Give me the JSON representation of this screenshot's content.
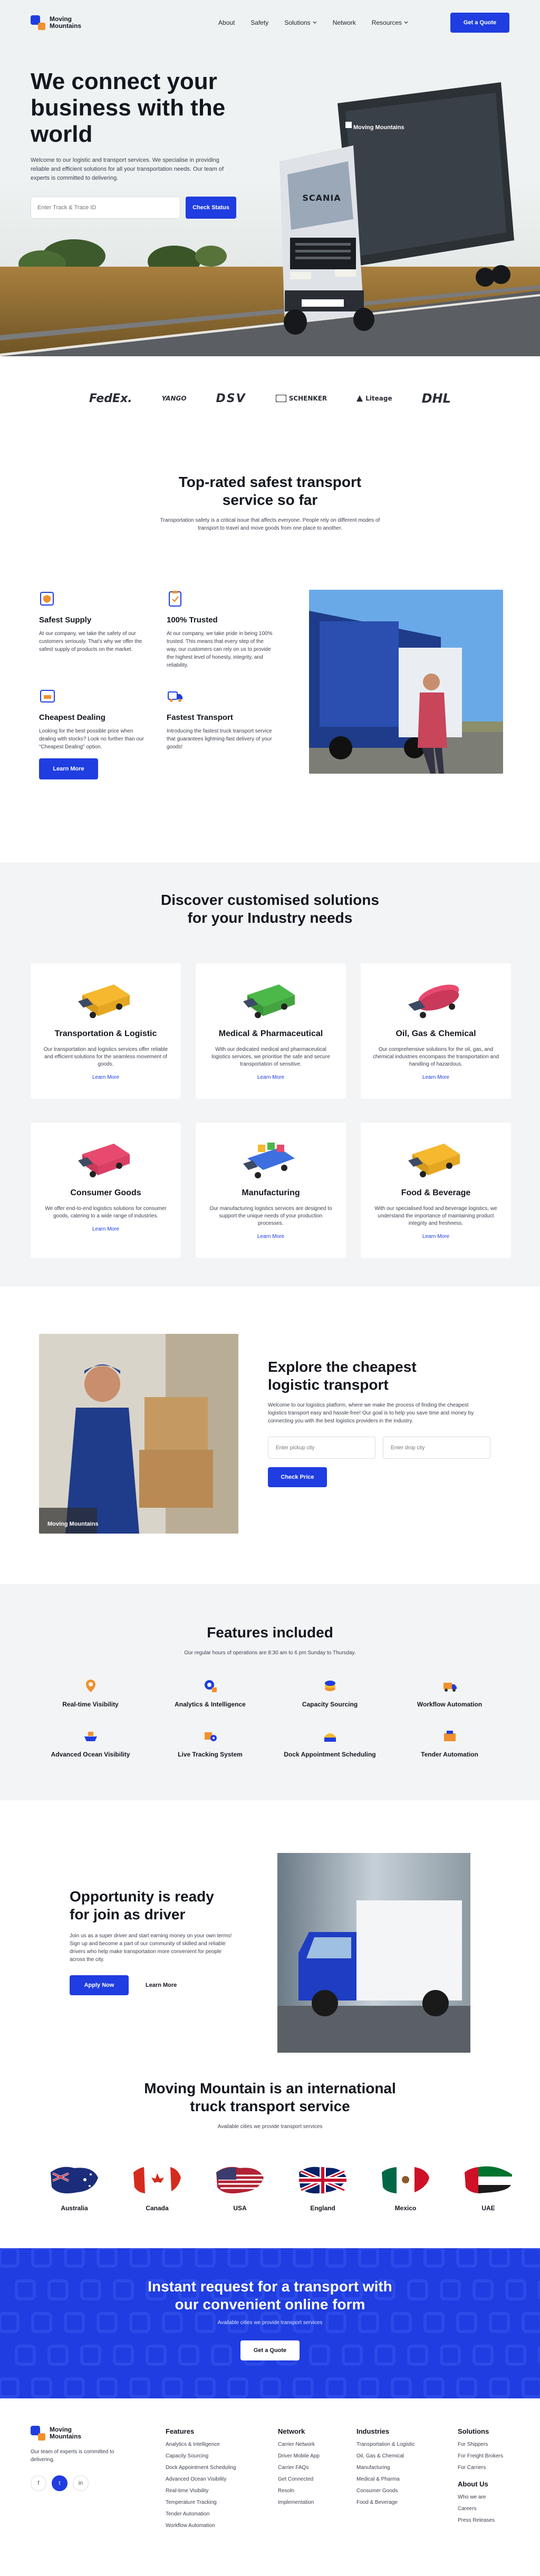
{
  "brand": {
    "name_line1": "Moving",
    "name_line2": "Mountains"
  },
  "nav": {
    "links": [
      "About",
      "Safety",
      "Solutions",
      "Network",
      "Resources"
    ],
    "cta": "Get a Quote"
  },
  "hero": {
    "title": "We connect your business with the world",
    "text": "Welcome to our logistic and transport services. We specialise in providing reliable and efficient solutions for all your transportation needs. Our team of experts is committed to delivering.",
    "track_placeholder": "Enter Track & Trace ID",
    "track_button": "Check Status",
    "truck_brand": "SCANIA",
    "trailer_logo": "Moving Mountains"
  },
  "partners": [
    "FedEx.",
    "YANGO",
    "DSV",
    "SCHENKER",
    "Liteage",
    "DHL"
  ],
  "safest": {
    "title_line1": "Top-rated safest transport",
    "title_line2": "service so far",
    "subtitle": "Transportation safety is a critical issue that affects everyone. People rely on different modes of transport to travel and move goods from one place to another.",
    "features": [
      {
        "title": "Safest Supply",
        "text": "At our company, we take the safety of our customers seriously. That's why we offer the safest supply of products on the market.",
        "icon": "shield-box-icon"
      },
      {
        "title": "100% Trusted",
        "text": "At our company, we take pride in being 100% trusted. This means that every step of the way, our customers can rely on us to provide the highest level of honesty, integrity, and reliability.",
        "icon": "clipboard-check-icon"
      },
      {
        "title": "Cheapest Dealing",
        "text": "Looking for the best possible price when dealing with stocks? Look no further than our \"Cheapest Dealing\" option.",
        "icon": "tag-icon"
      },
      {
        "title": "Fastest Transport",
        "text": "Introducing the fastest truck transport service that guarantees lightning-fast delivery of your goods!",
        "icon": "truck-icon"
      }
    ],
    "button": "Learn More"
  },
  "solutions": {
    "title_line1": "Discover customised solutions",
    "title_line2": "for your Industry needs",
    "cards": [
      {
        "title": "Transportation & Logistic",
        "text": "Our transportation and logistics services offer reliable and efficient solutions for the seamless movement of goods.",
        "link": "Learn More",
        "color": "#f5b82e"
      },
      {
        "title": "Medical & Pharmaceutical",
        "text": "With our dedicated medical and pharmaceutical logistics services, we prioritise the safe and secure transportation of sensitive.",
        "link": "Learn More",
        "color": "#4cb84a"
      },
      {
        "title": "Oil, Gas & Chemical",
        "text": "Our comprehensive solutions for the oil, gas, and chemical industries encompass the transportation and handling of hazardous.",
        "link": "Learn More",
        "color": "#e84a6f"
      },
      {
        "title": "Consumer Goods",
        "text": "We offer end-to-end logistics solutions for consumer goods, catering to a wide range of industries.",
        "link": "Learn More",
        "color": "#e84a6f"
      },
      {
        "title": "Manufacturing",
        "text": "Our manufacturing logistics services are designed to support the unique needs of your production processes.",
        "link": "Learn More",
        "color": "#3d6fe0"
      },
      {
        "title": "Food & Beverage",
        "text": "With our specialised food and beverage logistics, we understand the importance of maintaining product integrity and freshness.",
        "link": "Learn More",
        "color": "#f5b82e"
      }
    ]
  },
  "cheapest": {
    "title_line1": "Explore the cheapest",
    "title_line2": "logistic transport",
    "text": "Welcome to our logistics platform, where we make the process of finding the cheapest logistics transport easy and hassle-free! Our goal is to help you save time and money by connecting you with the best logistics providers in the industry.",
    "pickup_placeholder": "Enter pickup city",
    "drop_placeholder": "Enter drop city",
    "button": "Check Price",
    "photo_logo": "Moving Mountains"
  },
  "included": {
    "title": "Features included",
    "subtitle": "Our regular hours of operations are 8:30 am to 6 pm Sunday to Thursday.",
    "items": [
      {
        "label": "Real-time Visibility",
        "icon": "location-pin-icon"
      },
      {
        "label": "Analytics & Intelligence",
        "icon": "settings-chart-icon"
      },
      {
        "label": "Capacity Sourcing",
        "icon": "dollar-coins-icon"
      },
      {
        "label": "Workflow Automation",
        "icon": "truck-automation-icon"
      },
      {
        "label": "Advanced Ocean Visibility",
        "icon": "ship-icon"
      },
      {
        "label": "Live Tracking System",
        "icon": "tracking-box-icon"
      },
      {
        "label": "Dock Appointment Scheduling",
        "icon": "dock-calendar-icon"
      },
      {
        "label": "Tender Automation",
        "icon": "tender-box-icon"
      }
    ]
  },
  "driver": {
    "title_line1": "Opportunity is ready",
    "title_line2": "for join as driver",
    "text": "Join us as a super driver and start earning money on your own terms! Sign up and become a part of our community of skilled and reliable drivers who help make transportation more convenient for people across the city.",
    "apply": "Apply Now",
    "learn": "Learn More"
  },
  "countries": {
    "title_line1": "Moving Mountain is an international",
    "title_line2": "truck transport service",
    "subtitle": "Available cities we provide transport services",
    "list": [
      "Australia",
      "Canada",
      "USA",
      "England",
      "Mexico",
      "UAE"
    ]
  },
  "cta": {
    "title_line1": "Instant request for a transport with",
    "title_line2": "our convenient online form",
    "subtitle": "Available cities we provide transport services",
    "button": "Get a Quote"
  },
  "footer": {
    "tagline": "Our team of experts is committed to delivering.",
    "socials": [
      "f",
      "t",
      "in"
    ],
    "features": {
      "title": "Features",
      "items": [
        "Analytics & Intelligence",
        "Capacity Sourcing",
        "Dock Appointment Scheduling",
        "Advanced Ocean Visibility",
        "Real-time Visibility",
        "Temperature Tracking",
        "Tender Automation",
        "Workflow Automation"
      ]
    },
    "network": {
      "title": "Network",
      "items": [
        "Carrier Network",
        "Driver Mobile App",
        "Carrier FAQs",
        "Get Connected",
        "Resoln",
        "Implementation"
      ]
    },
    "industries": {
      "title": "Industries",
      "items": [
        "Transportation & Logistic",
        "Oil, Gas & Chemical",
        "Manufacturing",
        "Medical & Pharma",
        "Consumer Goods",
        "Food & Beverage"
      ]
    },
    "solutions": {
      "title": "Solutions",
      "items": [
        "For Shippers",
        "For Freight Brokers",
        "For Carriers"
      ]
    },
    "about": {
      "title": "About Us",
      "items": [
        "Who we are",
        "Careers",
        "Press Releases"
      ]
    }
  }
}
